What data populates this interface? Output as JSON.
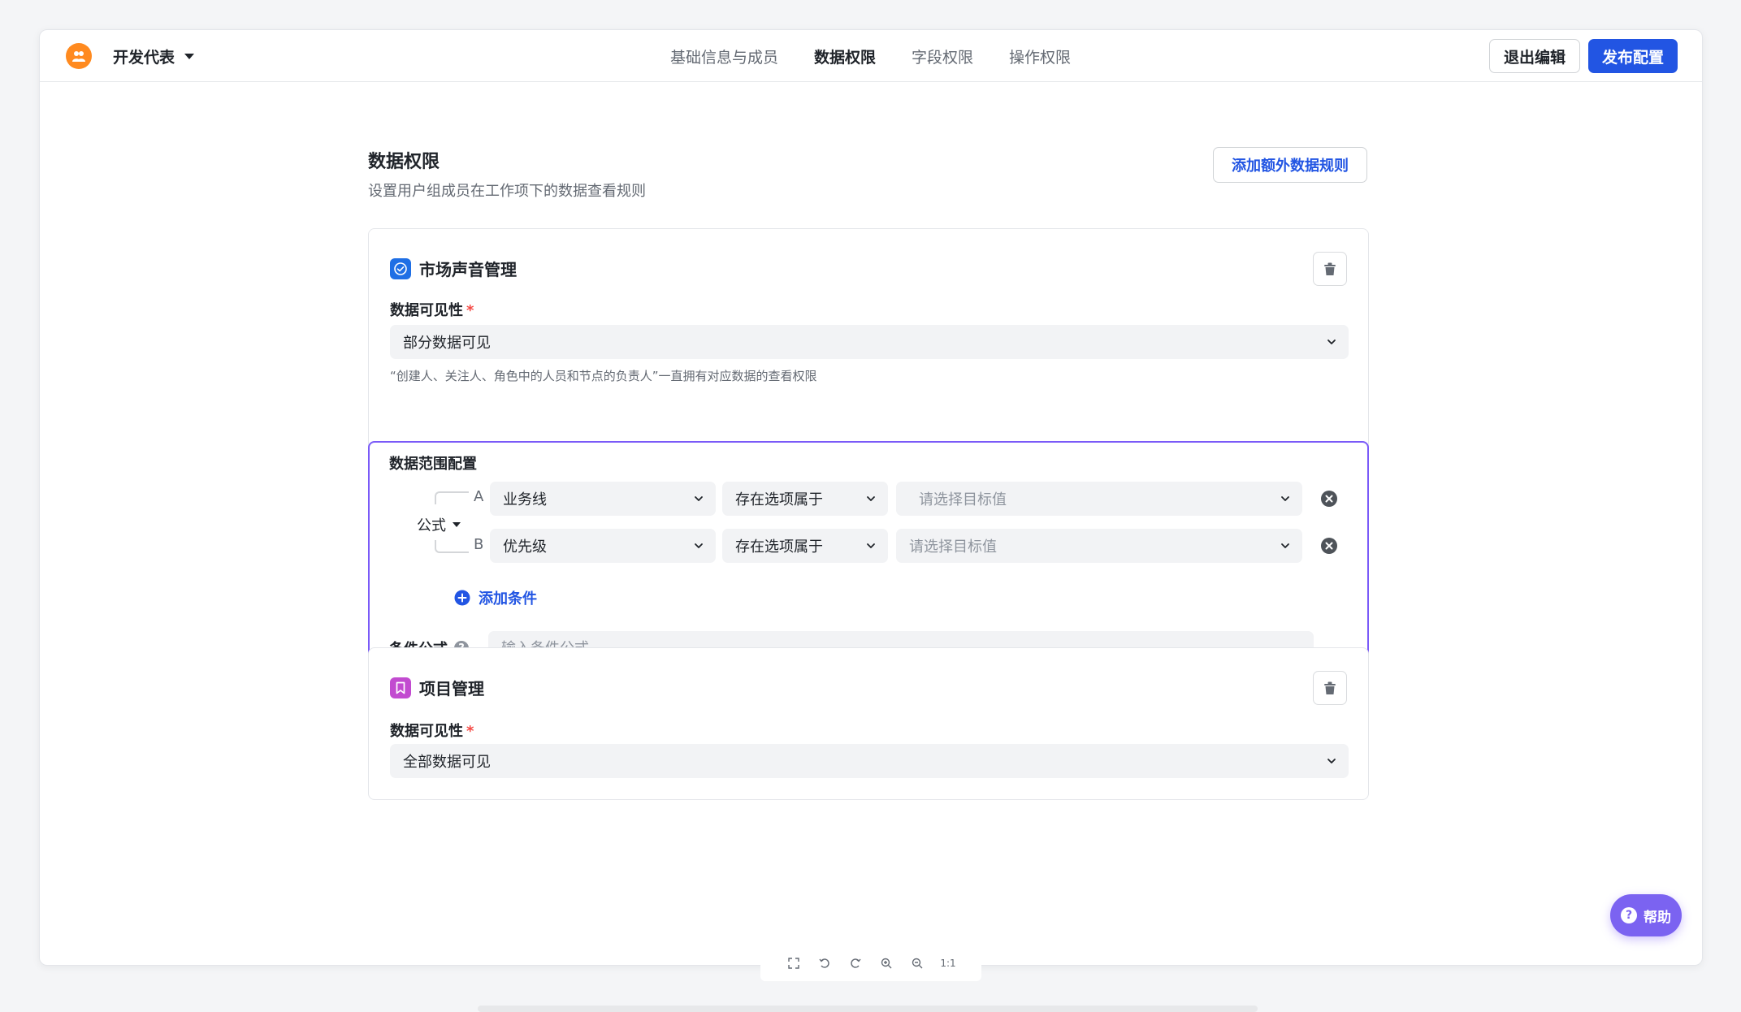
{
  "header": {
    "group_name": "开发代表",
    "tabs": [
      {
        "label": "基础信息与成员",
        "active": false
      },
      {
        "label": "数据权限",
        "active": true
      },
      {
        "label": "字段权限",
        "active": false
      },
      {
        "label": "操作权限",
        "active": false
      }
    ],
    "exit_label": "退出编辑",
    "publish_label": "发布配置"
  },
  "page": {
    "title": "数据权限",
    "description": "设置用户组成员在工作项下的数据查看规则",
    "add_rule_label": "添加额外数据规则"
  },
  "cards": [
    {
      "title": "市场声音管理",
      "icon": "check-circle-icon",
      "icon_color": "#1f6fe5",
      "visibility_label": "数据可见性",
      "required_mark": "*",
      "visibility_value": "部分数据可见",
      "hint": "“创建人、关注人、角色中的人员和节点的负责人”一直拥有对应数据的查看权限",
      "scope": {
        "title": "数据范围配置",
        "formula_toggle": "公式",
        "conditions": [
          {
            "letter": "A",
            "field": "业务线",
            "operator": "存在选项属于",
            "target_placeholder": "请选择目标值"
          },
          {
            "letter": "B",
            "field": "优先级",
            "operator": "存在选项属于",
            "target_placeholder": "请选择目标值"
          }
        ],
        "add_condition_label": "添加条件",
        "formula_label": "条件公式",
        "formula_placeholder": "输入条件公式"
      }
    },
    {
      "title": "项目管理",
      "icon": "bookmark-icon",
      "icon_color": "#c24bd0",
      "visibility_label": "数据可见性",
      "required_mark": "*",
      "visibility_value": "全部数据可见"
    }
  ],
  "help_label": "帮助",
  "viewer_toolbar": {
    "actual_size_label": "1:1"
  },
  "colors": {
    "primary": "#2255e3",
    "scope_border": "#7a5af8",
    "help_bg": "#7b63f1",
    "logo_bg": "#ff8a1f"
  }
}
